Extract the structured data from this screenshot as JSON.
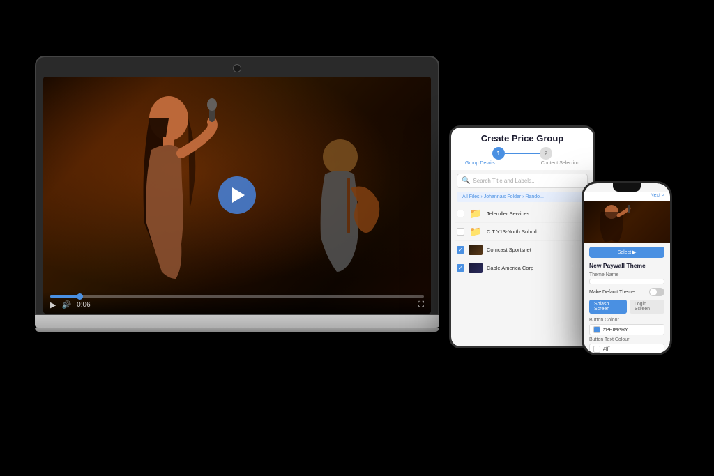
{
  "scene": {
    "bg": "#000000"
  },
  "laptop": {
    "video": {
      "time": "0:06",
      "progress": 8
    },
    "controls": {
      "play": "▶",
      "volume": "🔊",
      "fullscreen": "⛶"
    }
  },
  "tablet": {
    "title": "Create Price Group",
    "steps": {
      "step1": "1",
      "step2": "2",
      "label1": "Group Details",
      "label2": "Content Selection"
    },
    "search_placeholder": "Search Title and Labels...",
    "breadcrumb": "All Files › Johanna's Folder › Rando...",
    "items": [
      {
        "label": "Teleroller Services",
        "checked": false,
        "type": "folder"
      },
      {
        "label": "C T Y13-North Suburb...",
        "checked": false,
        "type": "folder"
      },
      {
        "label": "Comcast Sportsnet",
        "checked": true,
        "type": "video"
      },
      {
        "label": "Cable America Corp",
        "checked": true,
        "type": "video"
      }
    ]
  },
  "phone": {
    "header_title": "",
    "header_btn": "Next >",
    "section_title": "New Paywall Theme",
    "field_theme_label": "Theme Name",
    "field_theme_placeholder": "",
    "toggle_label": "Make Default Theme",
    "tab1": "Splash Screen",
    "tab2": "Login Screen",
    "field_btn_color_label": "Button Colour",
    "field_btn_color_value": "#PRIMARY",
    "field_btn_text_label": "Button Text Colour",
    "field_btn_text_value": "#fff"
  }
}
